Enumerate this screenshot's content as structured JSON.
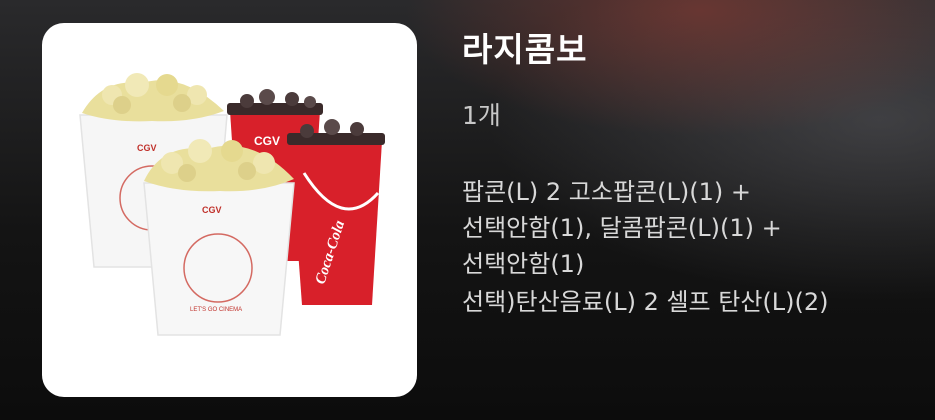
{
  "product": {
    "title": "라지콤보",
    "quantity": "1개",
    "description_lines": [
      "팝콘(L) 2 고소팝콘(L)(1) +",
      "선택안함(1), 달콤팝콘(L)(1) +",
      "선택안함(1)",
      "선택)탄산음료(L) 2 셀프 탄산(L)(2)"
    ],
    "image": {
      "bucket_brand": "CGV",
      "bucket_slogan": "LET'S GO CINEMA",
      "cup_brand": "CGV",
      "cup_logo": "Coca-Cola"
    }
  },
  "colors": {
    "card_bg": "#ffffff",
    "cup_red": "#d8202a",
    "popcorn": "#e9df9c",
    "bucket_line": "#c0302a"
  }
}
